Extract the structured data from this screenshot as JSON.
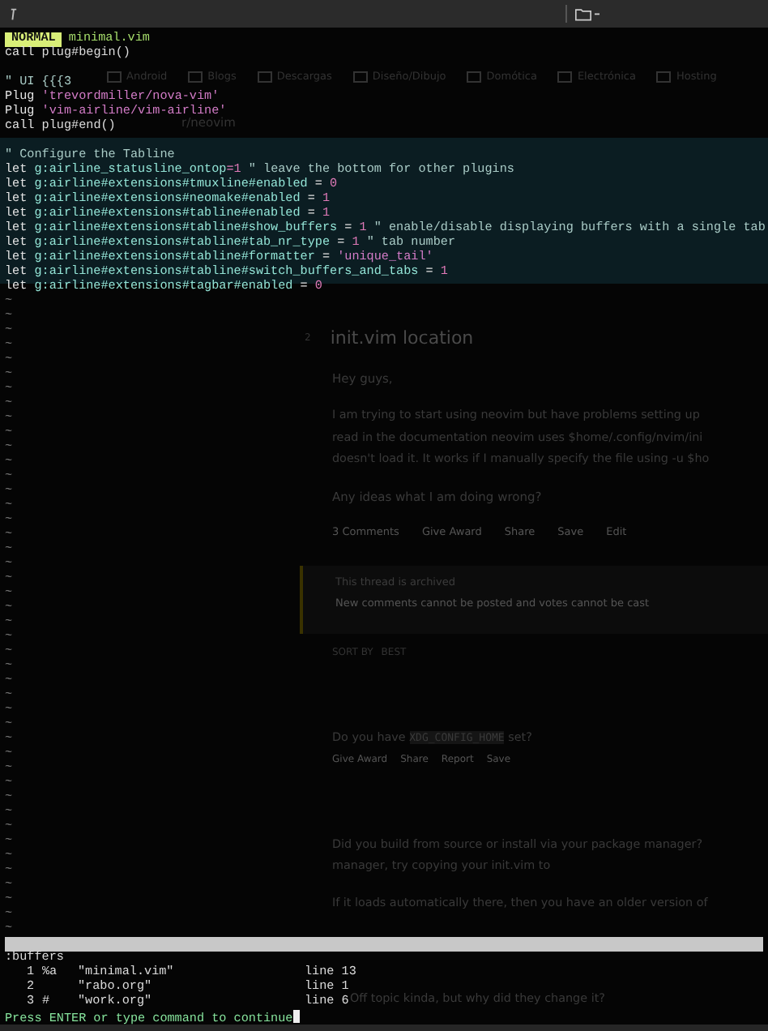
{
  "statusline": {
    "mode": "NORMAL",
    "file": "minimal.vim"
  },
  "lines": [
    {
      "kind": "code",
      "segments": [
        {
          "text": "call",
          "kind": "keyword"
        },
        {
          "text": " plug#begin()",
          "kind": "plain"
        }
      ]
    },
    {
      "kind": "blank"
    },
    {
      "kind": "code",
      "segments": [
        {
          "text": "\" UI {{{3",
          "kind": "comment"
        }
      ]
    },
    {
      "kind": "code",
      "segments": [
        {
          "text": "Plug ",
          "kind": "keyword"
        },
        {
          "text": "'trevordmiller/nova-vim'",
          "kind": "string"
        }
      ]
    },
    {
      "kind": "code",
      "segments": [
        {
          "text": "Plug ",
          "kind": "keyword"
        },
        {
          "text": "'vim-airline/vim-airline'",
          "kind": "string"
        }
      ]
    },
    {
      "kind": "code",
      "segments": [
        {
          "text": "call",
          "kind": "keyword"
        },
        {
          "text": " plug#end()",
          "kind": "plain"
        }
      ]
    },
    {
      "kind": "blank"
    },
    {
      "kind": "code",
      "segments": [
        {
          "text": "\" Configure the Tabline",
          "kind": "comment"
        }
      ]
    },
    {
      "kind": "code",
      "segments": [
        {
          "text": "let",
          "kind": "keyword"
        },
        {
          "text": " g:airline_statusline_ontop",
          "kind": "variable"
        },
        {
          "text": "=",
          "kind": "number"
        },
        {
          "text": "1",
          "kind": "number"
        },
        {
          "text": " \" leave the bottom for other plugins",
          "kind": "comment"
        }
      ]
    },
    {
      "kind": "code",
      "segments": [
        {
          "text": "let",
          "kind": "keyword"
        },
        {
          "text": " g:airline#extensions#tmuxline#enabled ",
          "kind": "variable"
        },
        {
          "text": "= ",
          "kind": "plain"
        },
        {
          "text": "0",
          "kind": "number"
        }
      ]
    },
    {
      "kind": "code",
      "segments": [
        {
          "text": "let",
          "kind": "keyword"
        },
        {
          "text": " g:airline#extensions#neomake#enabled ",
          "kind": "variable"
        },
        {
          "text": "= ",
          "kind": "plain"
        },
        {
          "text": "1",
          "kind": "number"
        }
      ]
    },
    {
      "kind": "code",
      "segments": [
        {
          "text": "let",
          "kind": "keyword"
        },
        {
          "text": " g:airline#extensions#tabline#enabled ",
          "kind": "variable"
        },
        {
          "text": "= ",
          "kind": "plain"
        },
        {
          "text": "1",
          "kind": "number"
        }
      ]
    },
    {
      "kind": "code",
      "segments": [
        {
          "text": "let",
          "kind": "keyword"
        },
        {
          "text": " g:airline#extensions#tabline#show_buffers ",
          "kind": "variable"
        },
        {
          "text": "= ",
          "kind": "plain"
        },
        {
          "text": "1",
          "kind": "number"
        },
        {
          "text": " \" enable/disable displaying buffers with a single tab",
          "kind": "comment"
        }
      ]
    },
    {
      "kind": "code",
      "segments": [
        {
          "text": "let",
          "kind": "keyword"
        },
        {
          "text": " g:airline#extensions#tabline#tab_nr_type ",
          "kind": "variable"
        },
        {
          "text": "= ",
          "kind": "plain"
        },
        {
          "text": "1",
          "kind": "number"
        },
        {
          "text": " \" tab number",
          "kind": "comment"
        }
      ]
    },
    {
      "kind": "code",
      "segments": [
        {
          "text": "let",
          "kind": "keyword"
        },
        {
          "text": " g:airline#extensions#tabline#formatter ",
          "kind": "variable"
        },
        {
          "text": "= ",
          "kind": "plain"
        },
        {
          "text": "'unique_tail'",
          "kind": "string"
        }
      ]
    },
    {
      "kind": "code",
      "segments": [
        {
          "text": "let",
          "kind": "keyword"
        },
        {
          "text": " g:airline#extensions#tabline#switch_buffers_and_tabs ",
          "kind": "variable"
        },
        {
          "text": "= ",
          "kind": "plain"
        },
        {
          "text": "1",
          "kind": "number"
        }
      ]
    },
    {
      "kind": "code",
      "segments": [
        {
          "text": "let",
          "kind": "keyword"
        },
        {
          "text": " g:airline#extensions#tagbar#enabled ",
          "kind": "variable"
        },
        {
          "text": "= ",
          "kind": "plain"
        },
        {
          "text": "0",
          "kind": "number"
        }
      ]
    }
  ],
  "empty_line_markers": [
    "~",
    "~",
    "~",
    "~",
    "~",
    "~",
    "~",
    "~",
    "~",
    "~",
    "~",
    "~",
    "~",
    "~",
    "~",
    "~",
    "~",
    "~",
    "~",
    "~",
    "~",
    "~",
    "~",
    "~",
    "~",
    "~",
    "~",
    "~",
    "~",
    "~",
    "~",
    "~",
    "~",
    "~",
    "~",
    "~",
    "~",
    "~",
    "~",
    "~",
    "~",
    "~",
    "~",
    "~"
  ],
  "message": {
    "command": ":buffers",
    "buffers": [
      {
        "number": "1",
        "flags": "%a",
        "name": "\"minimal.vim\"",
        "line": "line 13"
      },
      {
        "number": "2",
        "name": "\"rabo.org\"",
        "line": "line 1"
      },
      {
        "number": "3",
        "flags": "#",
        "name": "\"work.org\"",
        "line": "line 6"
      }
    ],
    "prompt": "Press ENTER or type command to continue"
  },
  "background_page": {
    "bookmarks": [
      "Android",
      "Blogs",
      "Descargas",
      "Diseño/Dibujo",
      "Domótica",
      "Electrónica",
      "Hosting"
    ],
    "subreddit": "r/neovim",
    "post": {
      "score": "2",
      "title": "init.vim location",
      "greeting": "Hey guys,",
      "body": [
        "I am trying to start using neovim but have problems setting up",
        "read in the documentation neovim uses $home/.config/nvim/ini",
        "doesn't load it. It works if I manually specify the file using -u $ho"
      ],
      "question": "Any ideas what I am doing wrong?",
      "actions": [
        "3 Comments",
        "Give Award",
        "Share",
        "Save",
        "Edit"
      ]
    },
    "archived": {
      "title": "This thread is archived",
      "text": "New comments cannot be posted and votes cannot be cast"
    },
    "sort": {
      "label": "SORT BY",
      "value": "BEST"
    },
    "comments": [
      {
        "lines": [
          [
            {
              "text": "Do you have ",
              "kind": "text"
            },
            {
              "text": "XDG_CONFIG_HOME",
              "kind": "code"
            },
            {
              "text": " set?",
              "kind": "text"
            }
          ]
        ],
        "actions": [
          "Give Award",
          "Share",
          "Report",
          "Save"
        ]
      },
      {
        "lines": [
          [
            {
              "text": "Did you build from source or install via your package manager?",
              "kind": "text"
            }
          ],
          [
            {
              "text": "manager, try copying your init.vim to",
              "kind": "text"
            }
          ],
          [
            {
              "text": "If it loads automatically there, then you have an older version of",
              "kind": "text"
            }
          ]
        ]
      },
      {
        "lines": [
          [
            {
              "text": "Off topic kinda, but why did they change it?",
              "kind": "text"
            }
          ]
        ]
      }
    ]
  }
}
